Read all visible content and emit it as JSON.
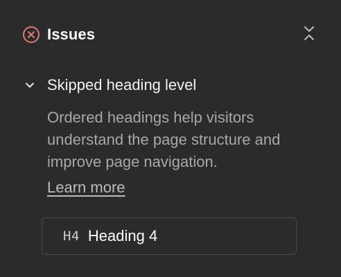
{
  "header": {
    "title": "Issues",
    "icons": {
      "status": "error-circle-icon",
      "action": "collapse-icon"
    }
  },
  "issue": {
    "title": "Skipped heading level",
    "description": "Ordered headings help visitors understand the page structure and improve page navigation.",
    "learn_more": "Learn more",
    "heading_tag": "H4",
    "heading_text": "Heading 4",
    "expanded": true
  },
  "colors": {
    "background": "#2b2b2b",
    "error_accent": "#e07a7a",
    "text_primary": "#ffffff",
    "text_secondary": "#a8a8a8",
    "border": "#4a4a4a"
  }
}
